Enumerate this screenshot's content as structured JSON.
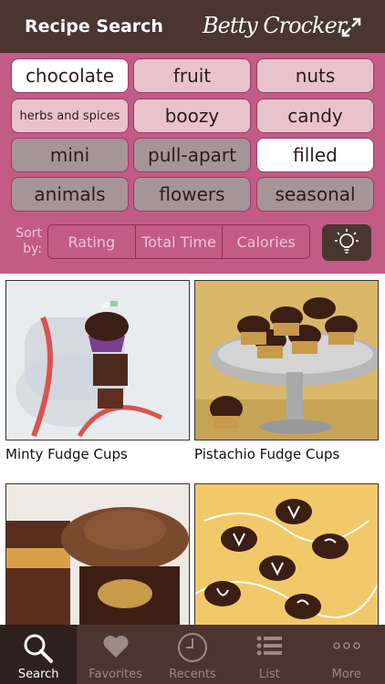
{
  "header": {
    "title": "Recipe Search",
    "brand": "Betty Crocker"
  },
  "filters": {
    "chips": [
      {
        "label": "chocolate",
        "state": "selected"
      },
      {
        "label": "fruit",
        "state": "normal"
      },
      {
        "label": "nuts",
        "state": "normal"
      },
      {
        "label": "herbs and spices",
        "state": "normal"
      },
      {
        "label": "boozy",
        "state": "normal"
      },
      {
        "label": "candy",
        "state": "normal"
      },
      {
        "label": "mini",
        "state": "dimmed"
      },
      {
        "label": "pull-apart",
        "state": "dimmed"
      },
      {
        "label": "filled",
        "state": "selected"
      },
      {
        "label": "animals",
        "state": "dimmed"
      },
      {
        "label": "flowers",
        "state": "dimmed"
      },
      {
        "label": "seasonal",
        "state": "dimmed"
      }
    ]
  },
  "sort": {
    "label": "Sort by:",
    "options": [
      "Rating",
      "Total Time",
      "Calories"
    ]
  },
  "recipes": [
    {
      "name": "Minty Fudge Cups"
    },
    {
      "name": "Pistachio Fudge Cups"
    },
    {
      "name": ""
    },
    {
      "name": ""
    }
  ],
  "tabbar": {
    "tabs": [
      {
        "label": "Search",
        "icon": "search-icon",
        "active": true
      },
      {
        "label": "Favorites",
        "icon": "heart-icon",
        "active": false
      },
      {
        "label": "Recents",
        "icon": "clock-icon",
        "active": false
      },
      {
        "label": "List",
        "icon": "list-icon",
        "active": false
      },
      {
        "label": "More",
        "icon": "more-icon",
        "active": false
      }
    ]
  },
  "colors": {
    "header": "#4a3530",
    "filter_bg": "#c25b85",
    "chip": "#e8c3cd",
    "chip_dimmed": "#a79499",
    "chip_selected": "#ffffff"
  }
}
